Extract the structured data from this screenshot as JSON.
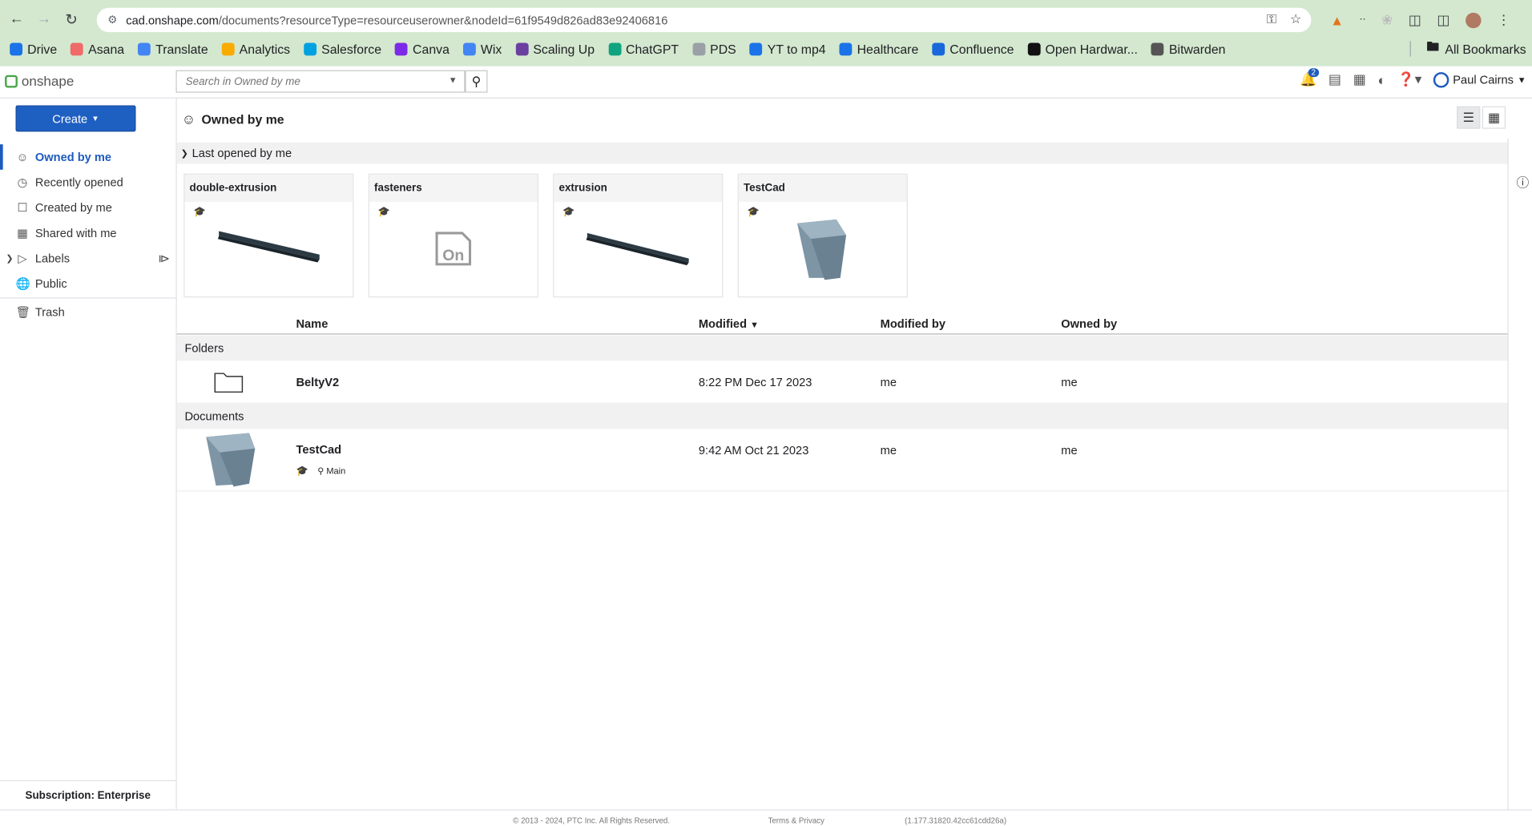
{
  "browser": {
    "url_host": "cad.onshape.com",
    "url_path": "/documents?resourceType=resourceuserowner&nodeId=61f9549d826ad83e92406816",
    "bookmarks": [
      {
        "label": "Drive",
        "color": "#1a73e8"
      },
      {
        "label": "Asana",
        "color": "#f06a6a"
      },
      {
        "label": "Translate",
        "color": "#4285f4"
      },
      {
        "label": "Analytics",
        "color": "#f9ab00"
      },
      {
        "label": "Salesforce",
        "color": "#00a1e0"
      },
      {
        "label": "Canva",
        "color": "#7d2ae8"
      },
      {
        "label": "Wix",
        "color": "#4285f4"
      },
      {
        "label": "Scaling Up",
        "color": "#6a3fa0"
      },
      {
        "label": "ChatGPT",
        "color": "#10a37f"
      },
      {
        "label": "PDS",
        "color": "#9aa0a6"
      },
      {
        "label": "YT to mp4",
        "color": "#1a73e8"
      },
      {
        "label": "Healthcare",
        "color": "#1a73e8"
      },
      {
        "label": "Confluence",
        "color": "#1868db"
      },
      {
        "label": "Open Hardwar...",
        "color": "#111111"
      },
      {
        "label": "Bitwarden",
        "color": "#555555"
      }
    ],
    "all_bookmarks": "All Bookmarks"
  },
  "app": {
    "logo_text": "onshape",
    "search_placeholder": "Search in Owned by me",
    "notification_count": "2",
    "user_name": "Paul Cairns"
  },
  "sidebar": {
    "create_label": "Create",
    "items": [
      {
        "label": "Owned by me",
        "icon": "person-circle-icon"
      },
      {
        "label": "Recently opened",
        "icon": "clock-icon"
      },
      {
        "label": "Created by me",
        "icon": "document-icon"
      },
      {
        "label": "Shared with me",
        "icon": "shared-icon"
      },
      {
        "label": "Labels",
        "icon": "label-icon"
      },
      {
        "label": "Public",
        "icon": "globe-icon"
      },
      {
        "label": "Trash",
        "icon": "trash-icon"
      }
    ],
    "subscription_label": "Subscription:",
    "subscription_value": "Enterprise"
  },
  "main": {
    "title": "Owned by me",
    "recent_section": "Last opened by me",
    "cards": [
      {
        "title": "double-extrusion",
        "thumb": "bar"
      },
      {
        "title": "fasteners",
        "thumb": "onshape-placeholder"
      },
      {
        "title": "extrusion",
        "thumb": "bar"
      },
      {
        "title": "TestCad",
        "thumb": "cup"
      }
    ],
    "columns": {
      "name": "Name",
      "modified": "Modified",
      "modified_by": "Modified by",
      "owned_by": "Owned by"
    },
    "folders_label": "Folders",
    "folders": [
      {
        "name": "BeltyV2",
        "modified": "8:22 PM Dec 17 2023",
        "modified_by": "me",
        "owned_by": "me"
      }
    ],
    "documents_label": "Documents",
    "documents": [
      {
        "name": "TestCad",
        "branch": "Main",
        "modified": "9:42 AM Oct 21 2023",
        "modified_by": "me",
        "owned_by": "me"
      }
    ]
  },
  "footer": {
    "copyright": "© 2013 - 2024, PTC Inc. All Rights Reserved.",
    "terms": "Terms & Privacy",
    "version": "(1.177.31820.42cc61cdd26a)"
  },
  "colors": {
    "accent": "#1e5fc2",
    "browser_frame": "#d3e8cf"
  }
}
